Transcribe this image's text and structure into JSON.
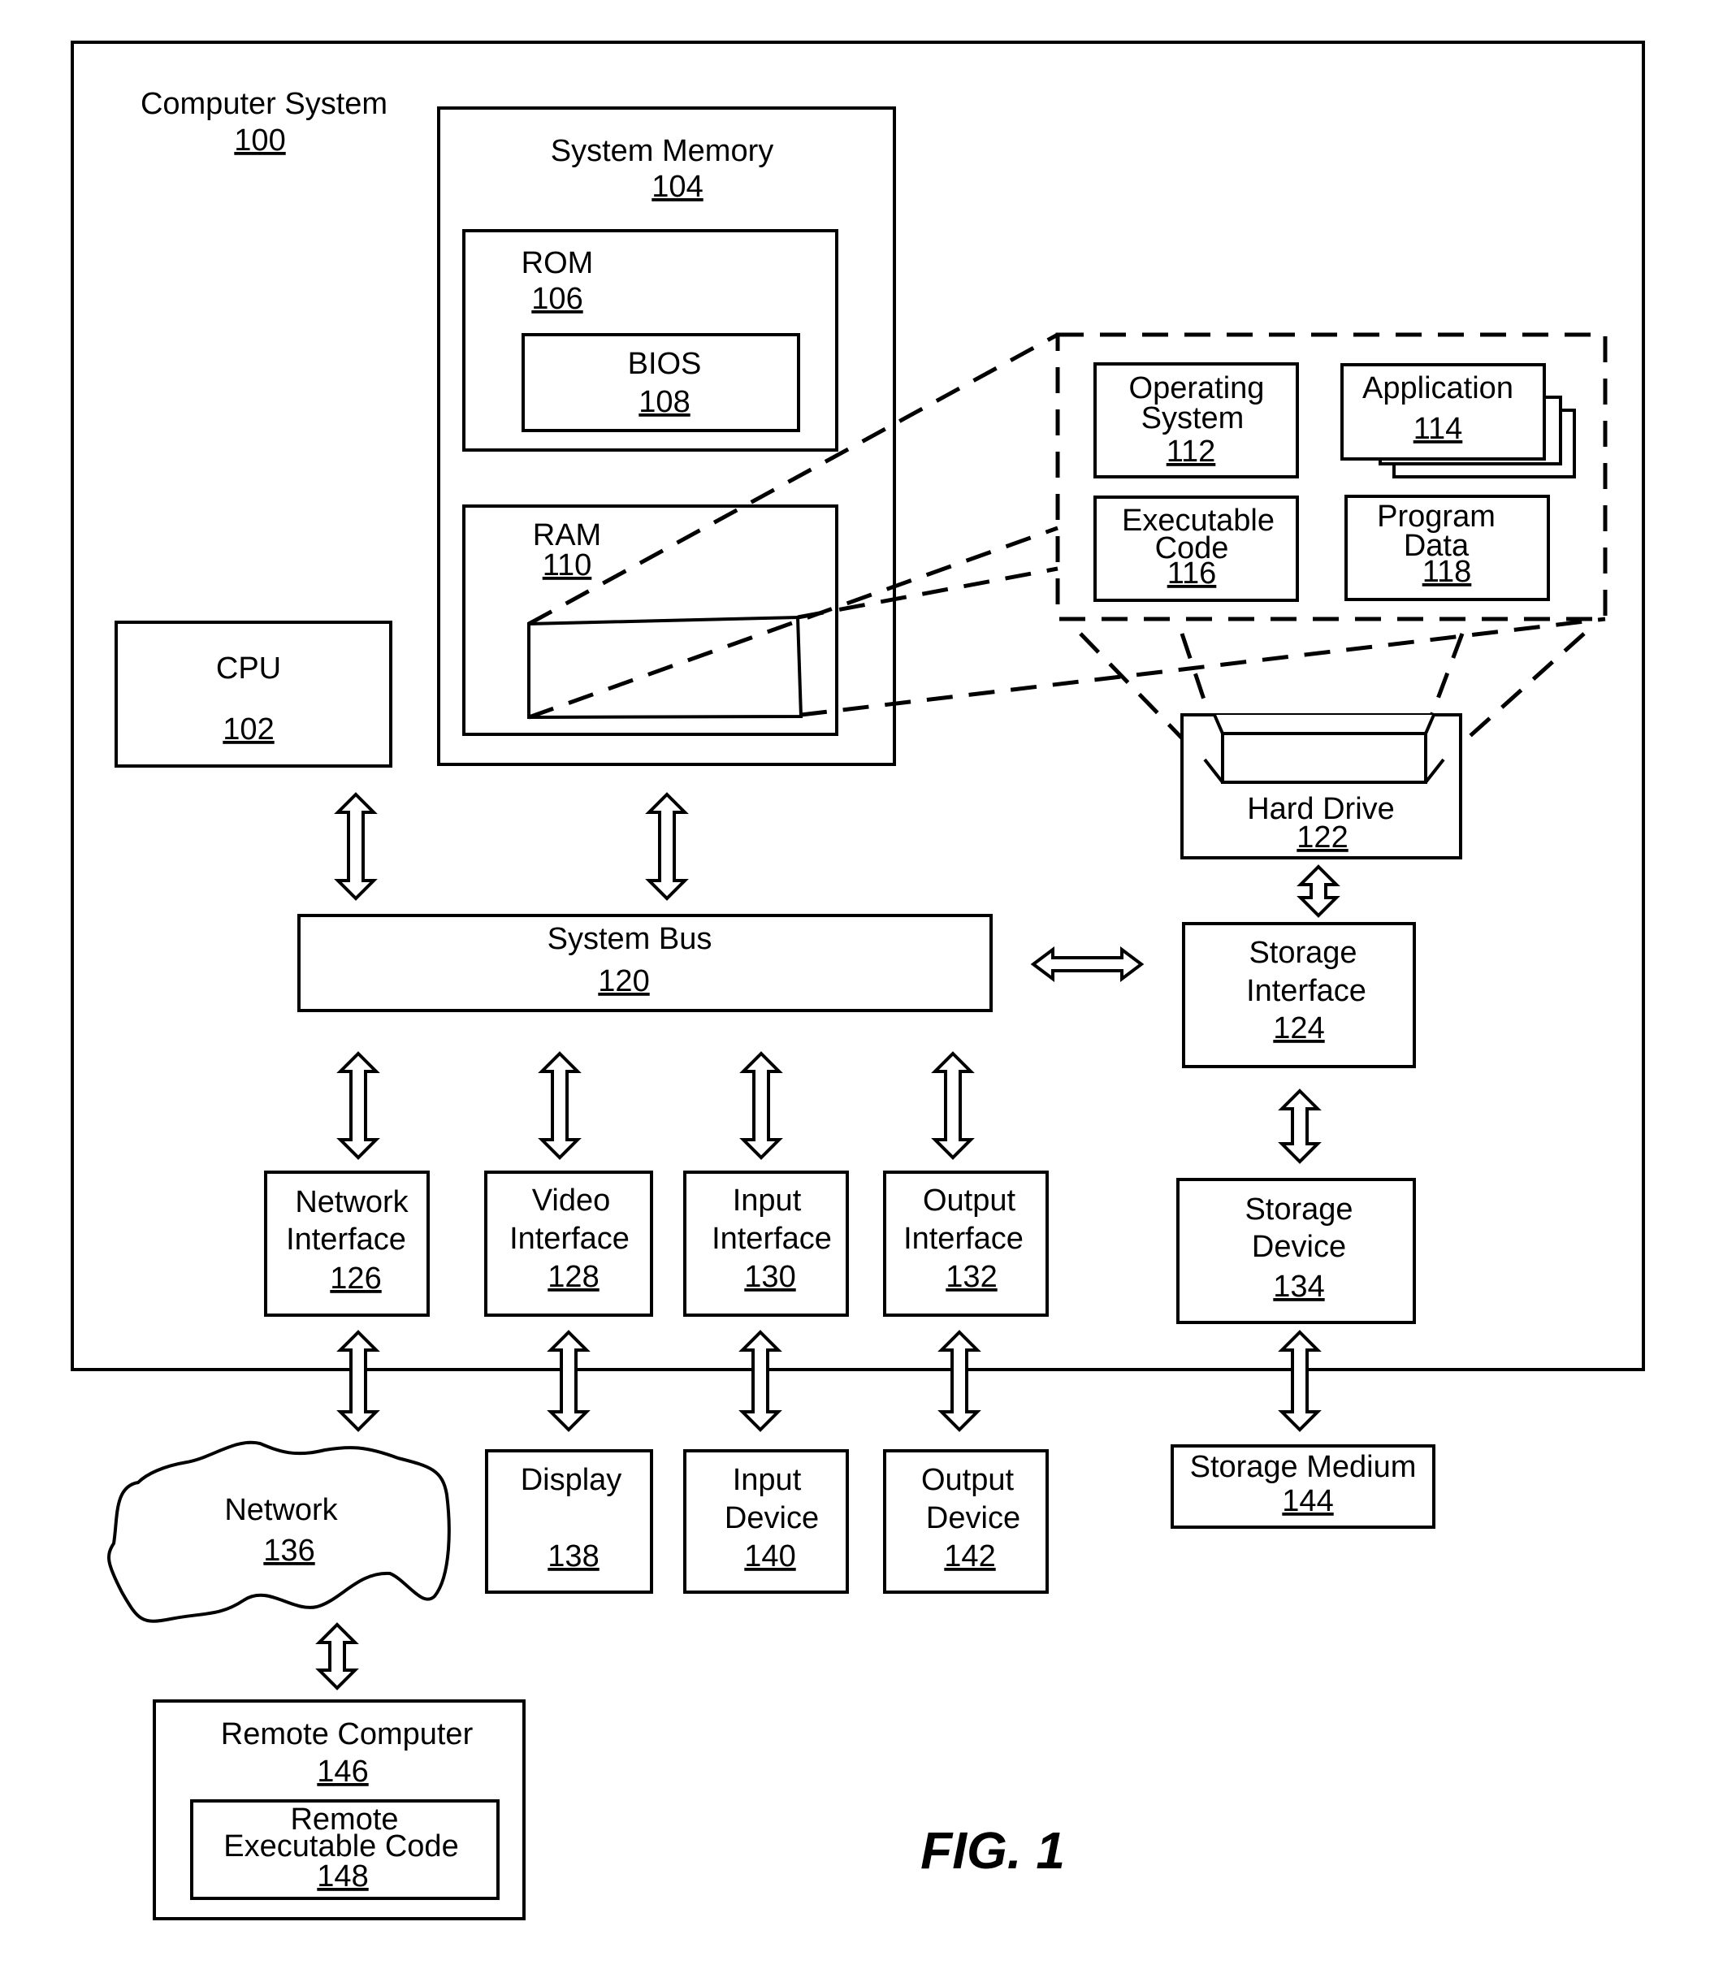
{
  "figure": {
    "label": "FIG. 1"
  },
  "components": {
    "computer_system": {
      "name": "Computer System",
      "ref": "100"
    },
    "cpu": {
      "name": "CPU",
      "ref": "102"
    },
    "system_memory": {
      "name": "System Memory",
      "ref": "104"
    },
    "rom": {
      "name": "ROM",
      "ref": "106"
    },
    "bios": {
      "name": "BIOS",
      "ref": "108"
    },
    "ram": {
      "name": "RAM",
      "ref": "110"
    },
    "operating_system": {
      "line1": "Operating",
      "line2": "System",
      "ref": "112"
    },
    "application": {
      "name": "Application",
      "ref": "114"
    },
    "executable_code": {
      "line1": "Executable",
      "line2": "Code",
      "ref": "116"
    },
    "program_data": {
      "line1": "Program",
      "line2": "Data",
      "ref": "118"
    },
    "system_bus": {
      "name": "System Bus",
      "ref": "120"
    },
    "hard_drive": {
      "name": "Hard Drive",
      "ref": "122"
    },
    "storage_interface": {
      "line1": "Storage",
      "line2": "Interface",
      "ref": "124"
    },
    "network_interface": {
      "line1": "Network",
      "line2": "Interface",
      "ref": "126"
    },
    "video_interface": {
      "line1": "Video",
      "line2": "Interface",
      "ref": "128"
    },
    "input_interface": {
      "line1": "Input",
      "line2": "Interface",
      "ref": "130"
    },
    "output_interface": {
      "line1": "Output",
      "line2": "Interface",
      "ref": "132"
    },
    "storage_device": {
      "line1": "Storage",
      "line2": "Device",
      "ref": "134"
    },
    "network": {
      "name": "Network",
      "ref": "136"
    },
    "display": {
      "name": "Display",
      "ref": "138"
    },
    "input_device": {
      "line1": "Input",
      "line2": "Device",
      "ref": "140"
    },
    "output_device": {
      "line1": "Output",
      "line2": "Device",
      "ref": "142"
    },
    "storage_medium": {
      "name": "Storage Medium",
      "ref": "144"
    },
    "remote_computer": {
      "name": "Remote Computer",
      "ref": "146"
    },
    "remote_executable_code": {
      "line1": "Remote",
      "line2": "Executable Code",
      "ref": "148"
    }
  }
}
